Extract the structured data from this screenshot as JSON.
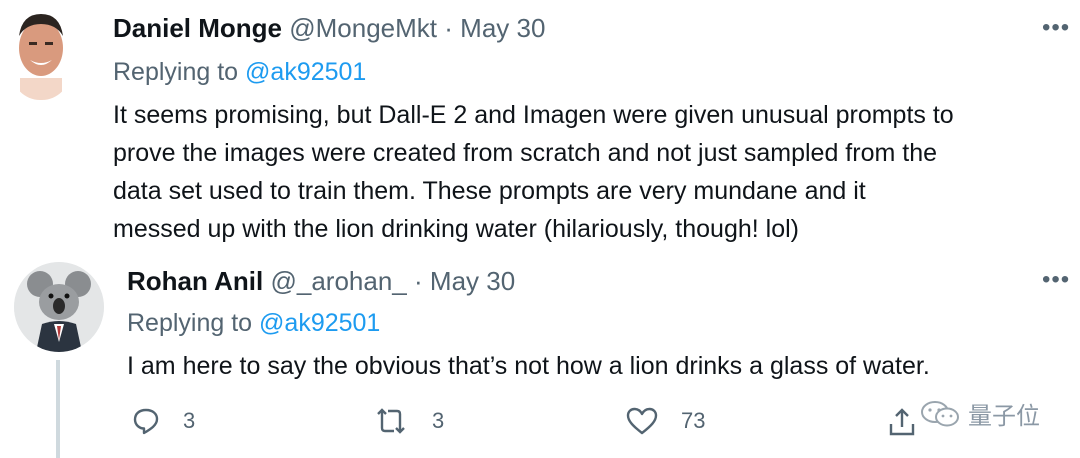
{
  "tweets": [
    {
      "author_name": "Daniel Monge",
      "handle": "@MongeMkt",
      "separator": "·",
      "date": "May 30",
      "replying_prefix": "Replying to",
      "replying_to": "@ak92501",
      "text_lines": [
        "It seems promising, but Dall-E 2 and Imagen were given unusual prompts to",
        "prove the images were created from scratch and not just sampled from the",
        "data set used to train them. These prompts are very mundane and it",
        "messed up with the lion drinking water (hilariously, though! lol)"
      ],
      "more_icon": "more-dots-icon"
    },
    {
      "author_name": "Rohan Anil",
      "handle": "@_arohan_",
      "separator": "·",
      "date": "May 30",
      "replying_prefix": "Replying to",
      "replying_to": "@ak92501",
      "text_lines": [
        "I am here to say the obvious that’s not how a lion drinks a glass of water."
      ],
      "more_icon": "more-dots-icon",
      "actions": {
        "reply_count": "3",
        "retweet_count": "3",
        "like_count": "73"
      }
    }
  ],
  "watermark": {
    "text": "量子位"
  },
  "colors": {
    "link": "#1d9bf0",
    "muted": "#536471",
    "text": "#0f1419"
  }
}
